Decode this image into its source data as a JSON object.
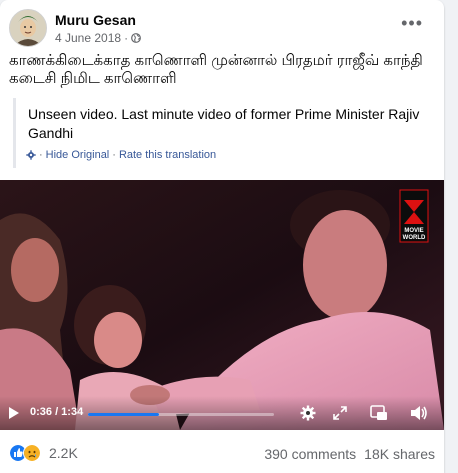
{
  "post": {
    "author": "Muru Gesan",
    "date": "4 June 2018",
    "separator": "·",
    "more_label": "•••",
    "text": "காணக்கிடைக்காத காணொளி முன்னால் பிரதமர் ராஜீவ் காந்தி கடைசி நிமிட காணொளி"
  },
  "translation": {
    "text": "Unseen video. Last minute video of former Prime Minister Rajiv Gandhi",
    "prefix": "·",
    "hide_label": "Hide Original",
    "dot": "·",
    "rate_label": "Rate this translation"
  },
  "video": {
    "watermark_top": "MOVIE",
    "watermark_bottom": "WORLD",
    "time": "0:36 / 1:34",
    "progress_fraction": 0.383,
    "buffer_fraction": 0.38
  },
  "footer": {
    "reaction_count": "2.2K",
    "comments": "390 comments",
    "shares": "18K shares"
  },
  "colors": {
    "link": "#385898",
    "muted": "#65676b",
    "progress": "#1877f2",
    "like": "#1877f2",
    "sad": "#f7b125"
  },
  "icons": [
    "globe-icon",
    "gear-icon",
    "play-icon",
    "settings-icon",
    "fullscreen-icon",
    "pip-icon",
    "volume-icon",
    "like-icon",
    "sad-icon"
  ]
}
